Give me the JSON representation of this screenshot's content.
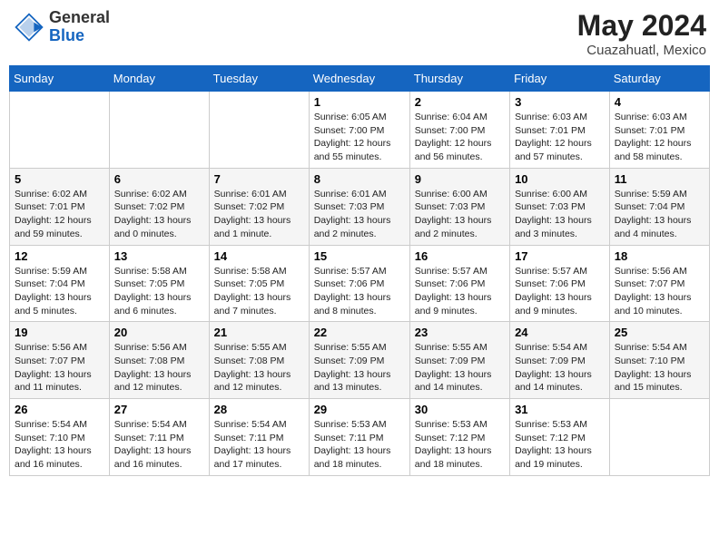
{
  "header": {
    "logo_general": "General",
    "logo_blue": "Blue",
    "month_title": "May 2024",
    "location": "Cuazahuatl, Mexico"
  },
  "weekdays": [
    "Sunday",
    "Monday",
    "Tuesday",
    "Wednesday",
    "Thursday",
    "Friday",
    "Saturday"
  ],
  "weeks": [
    [
      {
        "day": "",
        "info": ""
      },
      {
        "day": "",
        "info": ""
      },
      {
        "day": "",
        "info": ""
      },
      {
        "day": "1",
        "info": "Sunrise: 6:05 AM\nSunset: 7:00 PM\nDaylight: 12 hours\nand 55 minutes."
      },
      {
        "day": "2",
        "info": "Sunrise: 6:04 AM\nSunset: 7:00 PM\nDaylight: 12 hours\nand 56 minutes."
      },
      {
        "day": "3",
        "info": "Sunrise: 6:03 AM\nSunset: 7:01 PM\nDaylight: 12 hours\nand 57 minutes."
      },
      {
        "day": "4",
        "info": "Sunrise: 6:03 AM\nSunset: 7:01 PM\nDaylight: 12 hours\nand 58 minutes."
      }
    ],
    [
      {
        "day": "5",
        "info": "Sunrise: 6:02 AM\nSunset: 7:01 PM\nDaylight: 12 hours\nand 59 minutes."
      },
      {
        "day": "6",
        "info": "Sunrise: 6:02 AM\nSunset: 7:02 PM\nDaylight: 13 hours\nand 0 minutes."
      },
      {
        "day": "7",
        "info": "Sunrise: 6:01 AM\nSunset: 7:02 PM\nDaylight: 13 hours\nand 1 minute."
      },
      {
        "day": "8",
        "info": "Sunrise: 6:01 AM\nSunset: 7:03 PM\nDaylight: 13 hours\nand 2 minutes."
      },
      {
        "day": "9",
        "info": "Sunrise: 6:00 AM\nSunset: 7:03 PM\nDaylight: 13 hours\nand 2 minutes."
      },
      {
        "day": "10",
        "info": "Sunrise: 6:00 AM\nSunset: 7:03 PM\nDaylight: 13 hours\nand 3 minutes."
      },
      {
        "day": "11",
        "info": "Sunrise: 5:59 AM\nSunset: 7:04 PM\nDaylight: 13 hours\nand 4 minutes."
      }
    ],
    [
      {
        "day": "12",
        "info": "Sunrise: 5:59 AM\nSunset: 7:04 PM\nDaylight: 13 hours\nand 5 minutes."
      },
      {
        "day": "13",
        "info": "Sunrise: 5:58 AM\nSunset: 7:05 PM\nDaylight: 13 hours\nand 6 minutes."
      },
      {
        "day": "14",
        "info": "Sunrise: 5:58 AM\nSunset: 7:05 PM\nDaylight: 13 hours\nand 7 minutes."
      },
      {
        "day": "15",
        "info": "Sunrise: 5:57 AM\nSunset: 7:06 PM\nDaylight: 13 hours\nand 8 minutes."
      },
      {
        "day": "16",
        "info": "Sunrise: 5:57 AM\nSunset: 7:06 PM\nDaylight: 13 hours\nand 9 minutes."
      },
      {
        "day": "17",
        "info": "Sunrise: 5:57 AM\nSunset: 7:06 PM\nDaylight: 13 hours\nand 9 minutes."
      },
      {
        "day": "18",
        "info": "Sunrise: 5:56 AM\nSunset: 7:07 PM\nDaylight: 13 hours\nand 10 minutes."
      }
    ],
    [
      {
        "day": "19",
        "info": "Sunrise: 5:56 AM\nSunset: 7:07 PM\nDaylight: 13 hours\nand 11 minutes."
      },
      {
        "day": "20",
        "info": "Sunrise: 5:56 AM\nSunset: 7:08 PM\nDaylight: 13 hours\nand 12 minutes."
      },
      {
        "day": "21",
        "info": "Sunrise: 5:55 AM\nSunset: 7:08 PM\nDaylight: 13 hours\nand 12 minutes."
      },
      {
        "day": "22",
        "info": "Sunrise: 5:55 AM\nSunset: 7:09 PM\nDaylight: 13 hours\nand 13 minutes."
      },
      {
        "day": "23",
        "info": "Sunrise: 5:55 AM\nSunset: 7:09 PM\nDaylight: 13 hours\nand 14 minutes."
      },
      {
        "day": "24",
        "info": "Sunrise: 5:54 AM\nSunset: 7:09 PM\nDaylight: 13 hours\nand 14 minutes."
      },
      {
        "day": "25",
        "info": "Sunrise: 5:54 AM\nSunset: 7:10 PM\nDaylight: 13 hours\nand 15 minutes."
      }
    ],
    [
      {
        "day": "26",
        "info": "Sunrise: 5:54 AM\nSunset: 7:10 PM\nDaylight: 13 hours\nand 16 minutes."
      },
      {
        "day": "27",
        "info": "Sunrise: 5:54 AM\nSunset: 7:11 PM\nDaylight: 13 hours\nand 16 minutes."
      },
      {
        "day": "28",
        "info": "Sunrise: 5:54 AM\nSunset: 7:11 PM\nDaylight: 13 hours\nand 17 minutes."
      },
      {
        "day": "29",
        "info": "Sunrise: 5:53 AM\nSunset: 7:11 PM\nDaylight: 13 hours\nand 18 minutes."
      },
      {
        "day": "30",
        "info": "Sunrise: 5:53 AM\nSunset: 7:12 PM\nDaylight: 13 hours\nand 18 minutes."
      },
      {
        "day": "31",
        "info": "Sunrise: 5:53 AM\nSunset: 7:12 PM\nDaylight: 13 hours\nand 19 minutes."
      },
      {
        "day": "",
        "info": ""
      }
    ]
  ]
}
